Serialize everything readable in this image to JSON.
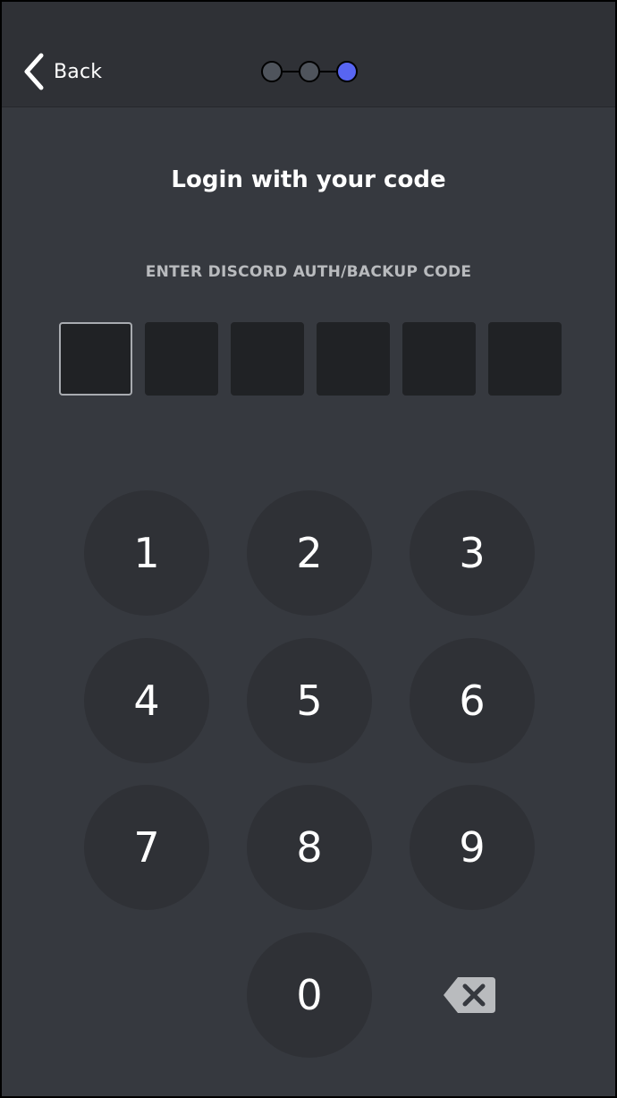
{
  "header": {
    "back_label": "Back",
    "steps_total": 3,
    "steps_current": 3,
    "step_inactive_color": "#4f545c",
    "step_active_color": "#5865f2"
  },
  "main": {
    "title": "Login with your code",
    "code_label": "ENTER DISCORD AUTH/BACKUP CODE",
    "code_length": 6,
    "code_value": ""
  },
  "keypad": {
    "keys": [
      "1",
      "2",
      "3",
      "4",
      "5",
      "6",
      "7",
      "8",
      "9",
      "0"
    ],
    "backspace_icon": "backspace-icon"
  },
  "colors": {
    "background": "#36393f",
    "header": "#2f3136",
    "key": "#2f3136",
    "input_box": "#202225",
    "text_primary": "#ffffff",
    "text_muted": "#b9bbbe"
  }
}
